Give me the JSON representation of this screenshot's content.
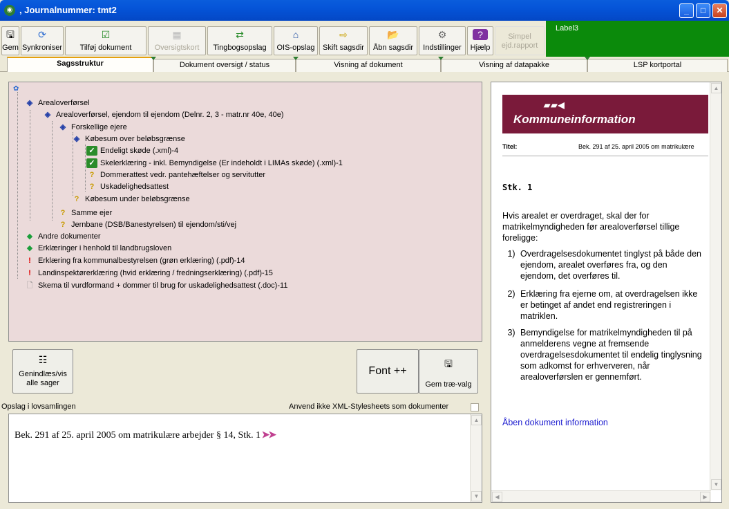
{
  "window": {
    "title": ", Journalnummer: tmt2",
    "buttons": [
      "_",
      "□",
      "✕"
    ]
  },
  "toolbar": {
    "buttons": [
      {
        "label": "Gem",
        "icon": "save-icon",
        "glyph": "🖫"
      },
      {
        "label": "Synkroniser",
        "icon": "sync-icon",
        "glyph": "⟳"
      },
      {
        "label": "Tilføj dokument",
        "icon": "add-document-icon",
        "glyph": "☑"
      },
      {
        "label": "Oversigtskort",
        "icon": "map-icon",
        "glyph": "▦",
        "disabled": true
      },
      {
        "label": "Tingbogsopslag",
        "icon": "book-lookup-icon",
        "glyph": "⇄"
      },
      {
        "label": "OIS-opslag",
        "icon": "ois-icon",
        "glyph": "⌂"
      },
      {
        "label": "Skift sagsdir",
        "icon": "change-folder-icon",
        "glyph": "⇨"
      },
      {
        "label": "Åbn sagsdir",
        "icon": "open-folder-icon",
        "glyph": "📂"
      },
      {
        "label": "Indstillinger",
        "icon": "settings-icon",
        "glyph": "⚙"
      },
      {
        "label": "Hjælp",
        "icon": "help-icon",
        "glyph": "?"
      },
      {
        "label": "Simpel ejd.rapport",
        "icon": "report-icon",
        "disabled": true
      }
    ],
    "label3": "Label3"
  },
  "tabs": [
    "Sagsstruktur",
    "Dokument oversigt / status",
    "Visning af dokument",
    "Visning af datapakke",
    "LSP kortportal"
  ],
  "tree": [
    {
      "label": "Arealoverførsel",
      "icon": "folder-icon",
      "glyph": "◈",
      "kind": "folder"
    },
    {
      "label": "Arealoverførsel, ejendom til ejendom (Delnr. 2, 3 - matr.nr 40e, 40e)",
      "icon": "folder-icon",
      "glyph": "◈",
      "kind": "folder"
    },
    {
      "label": "Forskellige ejere",
      "icon": "folder-icon",
      "glyph": "◈",
      "kind": "folder"
    },
    {
      "label": "Købesum over beløbsgrænse",
      "icon": "folder-icon",
      "glyph": "◈",
      "kind": "folder"
    },
    {
      "label": "Endeligt skøde (.xml)-4",
      "icon": "check-icon",
      "glyph": "✓",
      "kind": "check"
    },
    {
      "label": "Skelerklæring - inkl. Bemyndigelse (Er indeholdt i LIMAs skøde) (.xml)-1",
      "icon": "check-icon",
      "glyph": "✓",
      "kind": "check"
    },
    {
      "label": "Dommerattest vedr. pantehæftelser og servitutter",
      "icon": "question-icon",
      "glyph": "?",
      "kind": "question"
    },
    {
      "label": "Uskadelighedsattest",
      "icon": "question-icon",
      "glyph": "?",
      "kind": "question"
    },
    {
      "label": "Købesum under beløbsgrænse",
      "icon": "question-icon",
      "glyph": "?",
      "kind": "question"
    },
    {
      "label": "Samme ejer",
      "icon": "question-icon",
      "glyph": "?",
      "kind": "question"
    },
    {
      "label": "Jernbane (DSB/Banestyrelsen) til ejendom/sti/vej",
      "icon": "question-icon",
      "glyph": "?",
      "kind": "question"
    },
    {
      "label": "Andre dokumenter",
      "icon": "diamond-icon",
      "glyph": "◆",
      "kind": "diamond"
    },
    {
      "label": "Erklæringer i henhold til landbrugsloven",
      "icon": "diamond-icon",
      "glyph": "◆",
      "kind": "diamond"
    },
    {
      "label": "Erklæring fra kommunalbestyrelsen (grøn erklæring) (.pdf)-14",
      "icon": "warning-icon",
      "glyph": "!",
      "kind": "excl"
    },
    {
      "label": "Landinspektørerklæring (hvid erklæring / fredningserklæring) (.pdf)-15",
      "icon": "warning-icon",
      "glyph": "!",
      "kind": "excl"
    },
    {
      "label": "Skema til vurdformand + dommer til brug for uskadelighedsattest (.doc)-11",
      "icon": "document-icon",
      "glyph": "🗋",
      "kind": "doc"
    }
  ],
  "buttons": {
    "reload": "Genindlæs/vis alle sager",
    "font": "Font ++",
    "save_tree": "Gem træ-valg"
  },
  "law": {
    "label": "Opslag i lovsamlingen",
    "xml_label": "Anvend ikke XML-Stylesheets som dokumenter",
    "text": "Bek. 291 af 25. april 2005 om matrikulære arbejder § 14, Stk. 1"
  },
  "doc": {
    "header": "Kommuneinformation",
    "titel_key": "Titel:",
    "titel_value": "Bek. 291 af 25. april 2005 om matrikulære",
    "stk": "Stk. 1",
    "intro": "Hvis arealet er overdraget, skal der for matrikelmyndigheden før arealoverførsel tillige foreligge:",
    "paras": [
      {
        "num": "1)",
        "text": "Overdragelsesdokumentet tinglyst på både den ejendom, arealet overføres fra, og den ejendom, det overføres til."
      },
      {
        "num": "2)",
        "text": "Erklæring fra ejerne om, at overdragelsen ikke er betinget af andet end registreringen i matriklen."
      },
      {
        "num": "3)",
        "text": "Bemyndigelse for matrikelmyndigheden til på anmelderens vegne at fremsende overdragelsesdokumentet til endelig tinglysning som adkomst for erhververen, når arealoverførslen er gennemført."
      }
    ],
    "link": "Åben dokument information"
  }
}
